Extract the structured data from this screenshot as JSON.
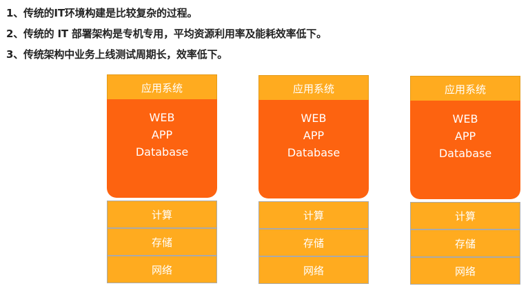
{
  "intro_lines": [
    "1、传统的IT环境构建是比较复杂的过程。",
    "2、传统的 IT 部署架构是专机专用，平均资源利用率及能耗效率低下。",
    "3、传统架构中业务上线测试周期长，效率低下。"
  ],
  "stacks": [
    {
      "app_title": "应用系统",
      "layers": [
        "WEB",
        "APP",
        "Database"
      ],
      "infra": [
        "计算",
        "存储",
        "网络"
      ]
    },
    {
      "app_title": "应用系统",
      "layers": [
        "WEB",
        "APP",
        "Database"
      ],
      "infra": [
        "计算",
        "存储",
        "网络"
      ]
    },
    {
      "app_title": "应用系统",
      "layers": [
        "WEB",
        "APP",
        "Database"
      ],
      "infra": [
        "计算",
        "存储",
        "网络"
      ]
    }
  ],
  "colors": {
    "header_orange": "#ffab1f",
    "body_orange": "#fd6310",
    "text_dark": "#222222"
  }
}
